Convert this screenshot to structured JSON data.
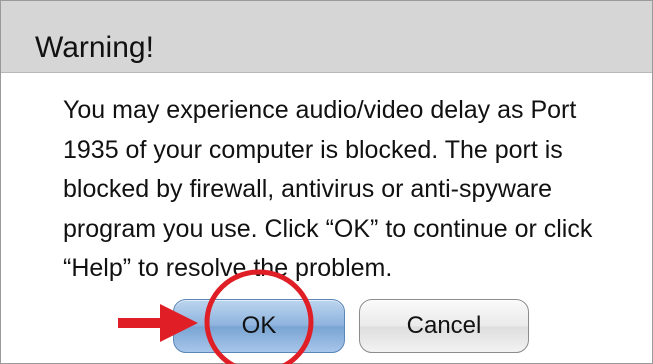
{
  "dialog": {
    "title": "Warning!",
    "message_lines": [
      "You may experience audio/video delay as Port",
      "1935 of your computer is blocked. The port is",
      "blocked by firewall, antivirus or anti-spyware",
      "program you use. Click “OK” to continue or click",
      "“Help” to resolve the problem."
    ],
    "ok_label": "OK",
    "cancel_label": "Cancel"
  },
  "annotation": {
    "arrow_icon": "red-arrow-icon",
    "circle_icon": "red-circle-highlight-icon",
    "color": "#e01e26"
  },
  "colors": {
    "header_bg": "#d6d6d6",
    "ok_button": "#8fb4de",
    "cancel_button": "#eaeaea"
  }
}
